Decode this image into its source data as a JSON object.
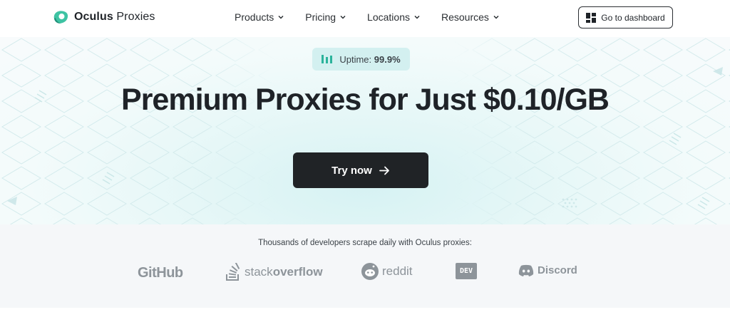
{
  "header": {
    "logo_name_regular": "Oculus",
    "logo_name_light": "Proxies",
    "nav": [
      {
        "label": "Products",
        "icon": "chevron-down-icon"
      },
      {
        "label": "Pricing",
        "icon": "chevron-down-icon"
      },
      {
        "label": "Locations",
        "icon": "chevron-down-icon"
      },
      {
        "label": "Resources",
        "icon": "chevron-down-icon"
      }
    ],
    "dashboard_button": {
      "label": "Go to dashboard",
      "icon": "dashboard-grid-icon"
    }
  },
  "hero": {
    "uptime": {
      "label": "Uptime:",
      "value": "99.9%",
      "icon": "signal-bars-icon"
    },
    "headline": "Premium Proxies for Just $0.10/GB",
    "cta": {
      "label": "Try now",
      "icon": "arrow-right-icon"
    }
  },
  "trusted": {
    "caption": "Thousands of developers scrape daily with Oculus proxies:",
    "brands": {
      "github": "GitHub",
      "stackoverflow_light": "stack",
      "stackoverflow_bold": "overflow",
      "reddit": "reddit",
      "dev": "DEV",
      "discord": "Discord"
    }
  },
  "colors": {
    "brand": "#2bb39b",
    "dark_button": "#202326",
    "uptime_bg": "#d3f0f0",
    "logo_gray": "#8d949a"
  }
}
